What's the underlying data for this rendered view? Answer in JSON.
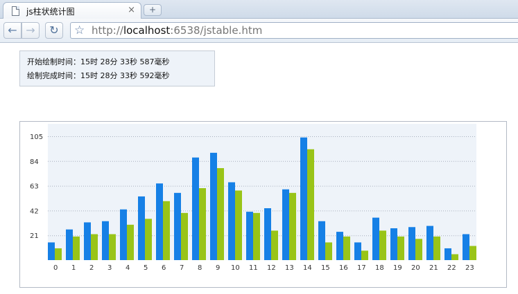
{
  "browser": {
    "tab_title": "js柱状统计图",
    "tab_close": "×",
    "new_tab": "+",
    "url_prefix": "http://",
    "url_host": "localhost",
    "url_path": ":6538/jstable.htm"
  },
  "timing": {
    "start": "开始绘制时间：15时 28分 33秒 587毫秒",
    "end": "绘制完成时间：15时 28分 33秒 592毫秒"
  },
  "colors": {
    "series_a": "#1680e6",
    "series_b": "#99c418",
    "plot_bg": "#eef3f9",
    "grid": "#a8b0bd"
  },
  "chart_data": {
    "type": "bar",
    "categories": [
      "0",
      "1",
      "2",
      "3",
      "4",
      "5",
      "6",
      "7",
      "8",
      "9",
      "10",
      "11",
      "12",
      "13",
      "14",
      "15",
      "16",
      "17",
      "18",
      "19",
      "20",
      "21",
      "22",
      "23"
    ],
    "series": [
      {
        "values": [
          15,
          26,
          32,
          33,
          43,
          54,
          65,
          57,
          87,
          91,
          66,
          41,
          44,
          60,
          104,
          33,
          24,
          15,
          36,
          27,
          28,
          29,
          10,
          22
        ]
      },
      {
        "values": [
          10,
          20,
          22,
          22,
          30,
          35,
          50,
          40,
          61,
          78,
          59,
          40,
          25,
          57,
          94,
          15,
          20,
          8,
          25,
          20,
          18,
          20,
          5,
          12
        ]
      }
    ],
    "yticks": [
      21,
      42,
      63,
      84,
      105
    ],
    "ylim": [
      0,
      105
    ],
    "grid": true
  }
}
